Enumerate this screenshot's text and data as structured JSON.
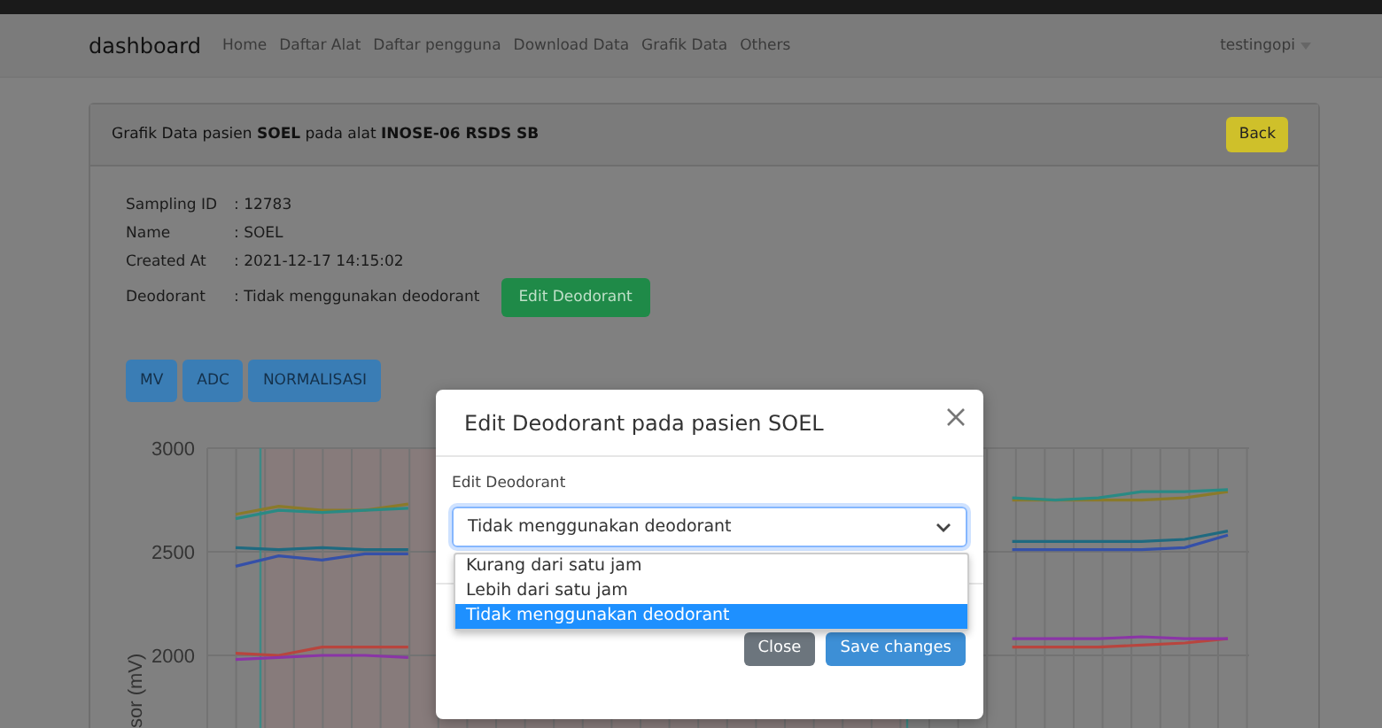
{
  "navbar": {
    "brand": "dashboard",
    "links": [
      "Home",
      "Daftar Alat",
      "Daftar pengguna",
      "Download Data",
      "Grafik Data",
      "Others"
    ],
    "user": "testingopi"
  },
  "card": {
    "header": "Grafik Data pasien **SOEL** pada alat **INOSE-06 RSDS SB**",
    "back_button": "Back",
    "info": [
      {
        "label": "Sampling ID",
        "value": ": 12783"
      },
      {
        "label": "Name",
        "value": ": SOEL"
      },
      {
        "label": "Created At",
        "value": ": 2021-12-17 14:15:02"
      },
      {
        "label": "Deodorant",
        "value": ": Tidak menggunakan deodorant"
      }
    ],
    "edit_button": "Edit Deodorant",
    "mode_buttons": [
      "MV",
      "ADC",
      "NORMALISASI"
    ],
    "chart_data": {
      "type": "line",
      "ylabel": "sor (mV)",
      "grid": true,
      "ylim": [
        1600,
        3000
      ],
      "yticks": [
        2000,
        2500,
        3000
      ],
      "series": [
        {
          "color": "#8a7a2a",
          "values": [
            2680,
            2720,
            2700,
            2700,
            2730,
            null,
            null,
            null,
            null,
            null,
            null,
            null,
            null,
            null,
            null,
            null,
            null,
            null,
            2750,
            2750,
            2750,
            2750,
            2760,
            2790
          ]
        },
        {
          "color": "#2a8a84",
          "values": [
            2660,
            2700,
            2690,
            2700,
            2710,
            null,
            null,
            null,
            null,
            null,
            null,
            null,
            null,
            null,
            null,
            null,
            null,
            null,
            2760,
            2750,
            2760,
            2790,
            2790,
            2800
          ]
        },
        {
          "color": "#1f6a80",
          "values": [
            2520,
            2510,
            2520,
            2510,
            2510,
            null,
            null,
            null,
            null,
            null,
            null,
            null,
            null,
            null,
            null,
            null,
            null,
            null,
            2550,
            2550,
            2550,
            2550,
            2560,
            2600
          ]
        },
        {
          "color": "#3550a8",
          "values": [
            2430,
            2480,
            2460,
            2490,
            2490,
            null,
            null,
            null,
            null,
            null,
            null,
            null,
            null,
            null,
            null,
            null,
            null,
            null,
            2510,
            2510,
            2510,
            2510,
            2520,
            2580
          ]
        },
        {
          "color": "#b8453e",
          "values": [
            2010,
            2000,
            2040,
            2040,
            2040,
            null,
            null,
            null,
            null,
            null,
            null,
            null,
            null,
            null,
            null,
            null,
            null,
            null,
            2040,
            2040,
            2040,
            2050,
            2060,
            2080
          ]
        },
        {
          "color": "#8a35a6",
          "values": [
            1980,
            1990,
            2000,
            2000,
            1990,
            null,
            null,
            null,
            null,
            null,
            null,
            null,
            null,
            null,
            null,
            null,
            null,
            null,
            2080,
            2080,
            2080,
            2090,
            2080,
            2080
          ]
        }
      ]
    }
  },
  "modal": {
    "title": "Edit Deodorant pada pasien SOEL",
    "label": "Edit Deodorant",
    "value": "Tidak menggunakan deodorant",
    "options": [
      {
        "label": "Kurang dari satu jam",
        "selected": false
      },
      {
        "label": "Lebih dari satu jam",
        "selected": false
      },
      {
        "label": "Tidak menggunakan deodorant",
        "selected": true
      }
    ],
    "buttons": [
      "Close",
      "Save changes"
    ]
  }
}
